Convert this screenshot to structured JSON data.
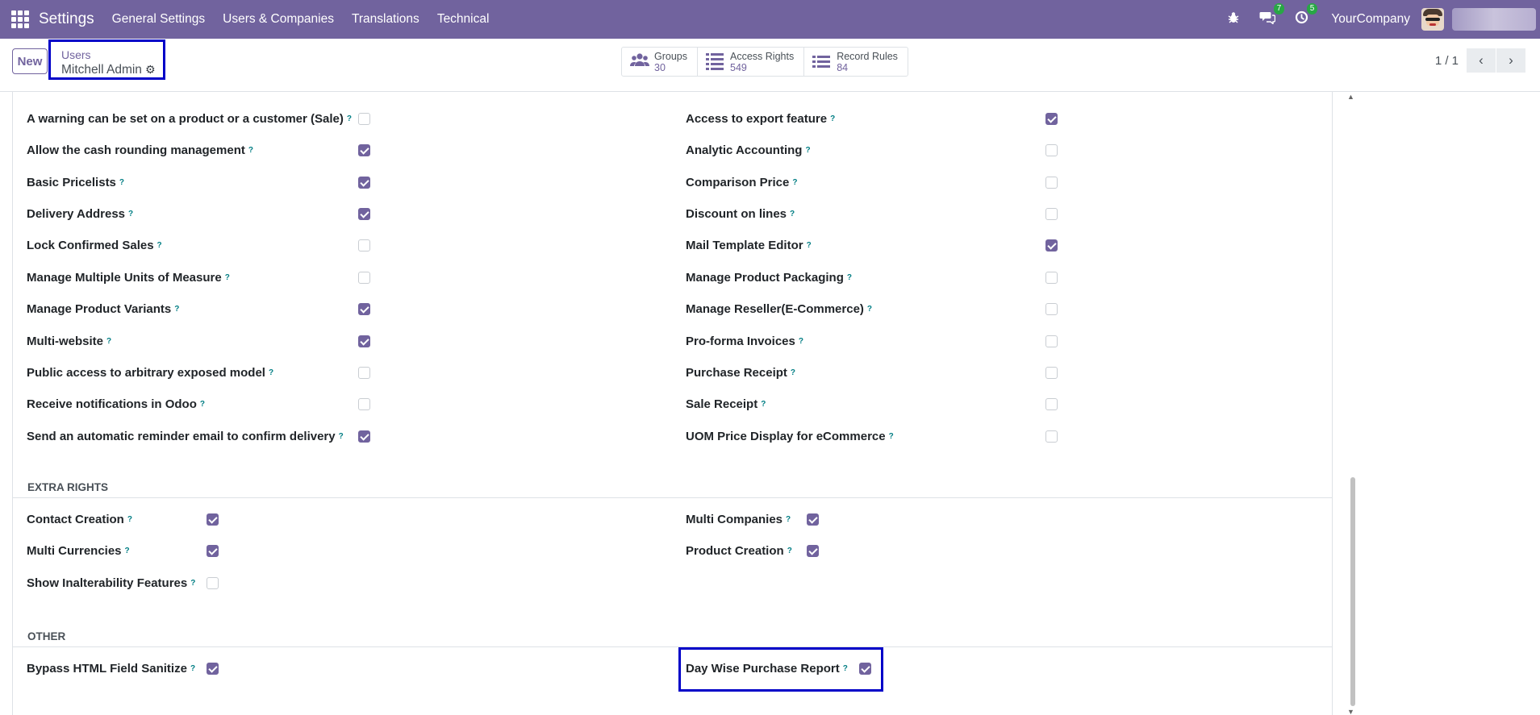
{
  "navbar": {
    "app_name": "Settings",
    "menu": [
      "General Settings",
      "Users & Companies",
      "Translations",
      "Technical"
    ],
    "messages_count": "7",
    "activities_count": "5",
    "company": "YourCompany"
  },
  "control": {
    "new_label": "New",
    "breadcrumb_parent": "Users",
    "breadcrumb_current": "Mitchell Admin",
    "smart_buttons": [
      {
        "label": "Groups",
        "value": "30",
        "icon": "users-icon"
      },
      {
        "label": "Access Rights",
        "value": "549",
        "icon": "list-icon"
      },
      {
        "label": "Record Rules",
        "value": "84",
        "icon": "list-icon"
      }
    ],
    "pager": "1 / 1"
  },
  "technical_left": [
    {
      "label": "A warning can be set on a product or a customer (Sale)",
      "checked": false
    },
    {
      "label": "Allow the cash rounding management",
      "checked": true
    },
    {
      "label": "Basic Pricelists",
      "checked": true
    },
    {
      "label": "Delivery Address",
      "checked": true
    },
    {
      "label": "Lock Confirmed Sales",
      "checked": false
    },
    {
      "label": "Manage Multiple Units of Measure",
      "checked": false
    },
    {
      "label": "Manage Product Variants",
      "checked": true
    },
    {
      "label": "Multi-website",
      "checked": true
    },
    {
      "label": "Public access to arbitrary exposed model",
      "checked": false
    },
    {
      "label": "Receive notifications in Odoo",
      "checked": false
    },
    {
      "label": "Send an automatic reminder email to confirm delivery",
      "checked": true
    }
  ],
  "technical_right": [
    {
      "label": "Access to export feature",
      "checked": true
    },
    {
      "label": "Analytic Accounting",
      "checked": false
    },
    {
      "label": "Comparison Price",
      "checked": false
    },
    {
      "label": "Discount on lines",
      "checked": false
    },
    {
      "label": "Mail Template Editor",
      "checked": true
    },
    {
      "label": "Manage Product Packaging",
      "checked": false
    },
    {
      "label": "Manage Reseller(E-Commerce)",
      "checked": false
    },
    {
      "label": "Pro-forma Invoices",
      "checked": false
    },
    {
      "label": "Purchase Receipt",
      "checked": false
    },
    {
      "label": "Sale Receipt",
      "checked": false
    },
    {
      "label": "UOM Price Display for eCommerce",
      "checked": false
    }
  ],
  "extra_rights": {
    "title": "EXTRA RIGHTS",
    "left": [
      {
        "label": "Contact Creation",
        "checked": true
      },
      {
        "label": "Multi Currencies",
        "checked": true
      },
      {
        "label": "Show Inalterability Features",
        "checked": false
      }
    ],
    "right": [
      {
        "label": "Multi Companies",
        "checked": true
      },
      {
        "label": "Product Creation",
        "checked": true
      }
    ]
  },
  "other": {
    "title": "OTHER",
    "left": [
      {
        "label": "Bypass HTML Field Sanitize",
        "checked": true
      }
    ],
    "right": [
      {
        "label": "Day Wise Purchase Report",
        "checked": true
      }
    ]
  },
  "help_mark": "?"
}
